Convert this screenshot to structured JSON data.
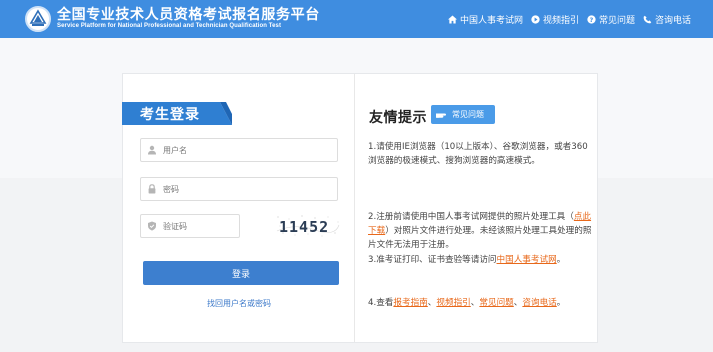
{
  "header": {
    "brand_cn": "全国专业技术人员资格考试报名服务平台",
    "brand_en": "Service Platform for National Professional and Technician Qualification Test",
    "nav": {
      "site": "中国人事考试网",
      "video": "视频指引",
      "faq": "常见问题",
      "phone": "咨询电话"
    }
  },
  "login": {
    "title": "考生登录",
    "username_placeholder": "用户名",
    "password_placeholder": "密码",
    "captcha_placeholder": "验证码",
    "captcha_text": "11452",
    "submit_label": "登录",
    "forgot_label": "找回用户名或密码"
  },
  "tips": {
    "title": "友情提示",
    "faq_badge": "常见问题",
    "tip1": "1.请使用IE浏览器（10以上版本）、谷歌浏览器，或者360浏览器的极速模式、搜狗浏览器的高速模式。",
    "tip2_a": "2.注册前请使用中国人事考试网提供的照片处理工具（",
    "tip2_link": "点此下载",
    "tip2_b": "）对照片文件进行处理。未经该照片处理工具处理的照片文件无法用于注册。",
    "tip3_a": "3.准考证打印、证书查验等请访问",
    "tip3_link": "中国人事考试网",
    "tip3_b": "。",
    "tip4_a": "4.查看",
    "tip4_link1": "报考指南",
    "tip4_sep1": "、",
    "tip4_link2": "视频指引",
    "tip4_sep2": "、",
    "tip4_link3": "常见问题",
    "tip4_sep3": "、",
    "tip4_link4": "咨询电话",
    "tip4_b": "。"
  },
  "colors": {
    "header_bg": "#3f8de0",
    "login_title_bg": "#2f7fd2",
    "button_bg": "#3d7fcf",
    "link_orange": "#e8681a",
    "link_blue": "#3b78c9"
  },
  "icons": [
    "logo-emblem",
    "home-icon",
    "play-icon",
    "question-icon",
    "phone-icon",
    "user-icon",
    "lock-icon",
    "shield-icon",
    "hand-pointer-icon"
  ]
}
